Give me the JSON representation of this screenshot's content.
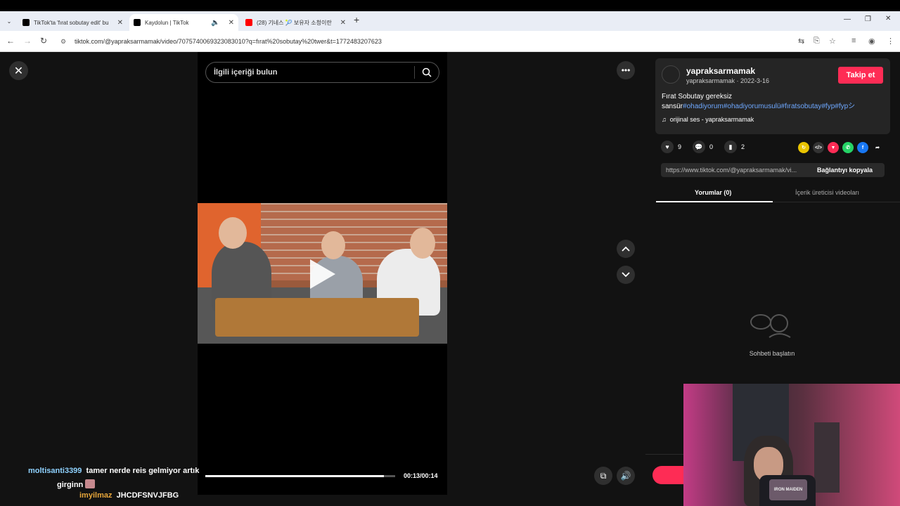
{
  "browser": {
    "tabs": [
      {
        "title": "TikTok'ta 'fırat sobutay edit' bu",
        "favicon_color": "#000000"
      },
      {
        "title": "Kaydolun | TikTok",
        "favicon_color": "#000000"
      },
      {
        "title": "(28) 기네스 🎾 보유자 소청이란",
        "favicon_color": "#ff0000"
      }
    ],
    "url": "tiktok.com/@yapraksarmamak/video/7075740069323083010?q=fırat%20sobutay%20twer&t=1772483207623"
  },
  "video": {
    "search_placeholder": "İlgili içeriği bulun",
    "time": "00:13/00:14",
    "progress": 0.94
  },
  "post": {
    "username": "yapraksarmamak",
    "meta": "yapraksarmamak · 2022-3-16",
    "follow_label": "Takip et",
    "caption_text": "Fırat Sobutay gereksiz sansür",
    "tags": [
      "#ohadiyorum",
      "#ohadiyorumusulü",
      "#fıratsobutay",
      "#fyp",
      "#fypシ"
    ],
    "music": "orijinal ses - yapraksarmamak",
    "likes": "9",
    "comments": "0",
    "saves": "2",
    "link": "https://www.tiktok.com/@yapraksarmamak/vi...",
    "copy_label": "Bağlantıyı kopyala",
    "tab_comments": "Yorumlar (0)",
    "tab_creator": "İçerik üreticisi videoları",
    "empty_text": "Sohbeti başlatın"
  },
  "chat": [
    {
      "user": "moltisanti3399",
      "text": "tamer nerde reis gelmiyor artık"
    },
    {
      "user": "",
      "text": "girginn"
    },
    {
      "user": "imyilmaz",
      "text": "JHCDFSNVJFBG"
    }
  ],
  "webcam": {
    "shirt_text": "IRON MAIDEN"
  },
  "colors": {
    "accent": "#fe2c55",
    "tag": "#6ea8ff"
  }
}
